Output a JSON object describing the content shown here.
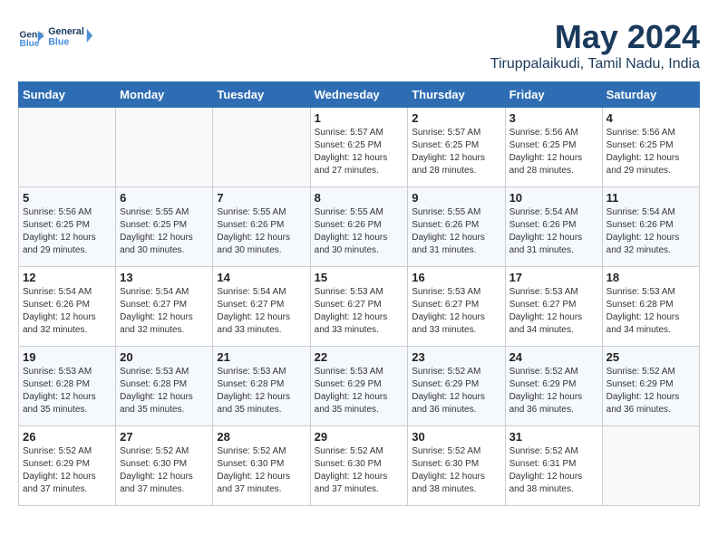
{
  "logo": {
    "text_general": "General",
    "text_blue": "Blue"
  },
  "title": "May 2024",
  "location": "Tiruppalaikudi, Tamil Nadu, India",
  "weekdays": [
    "Sunday",
    "Monday",
    "Tuesday",
    "Wednesday",
    "Thursday",
    "Friday",
    "Saturday"
  ],
  "weeks": [
    [
      {
        "day": "",
        "info": ""
      },
      {
        "day": "",
        "info": ""
      },
      {
        "day": "",
        "info": ""
      },
      {
        "day": "1",
        "info": "Sunrise: 5:57 AM\nSunset: 6:25 PM\nDaylight: 12 hours and 27 minutes."
      },
      {
        "day": "2",
        "info": "Sunrise: 5:57 AM\nSunset: 6:25 PM\nDaylight: 12 hours and 28 minutes."
      },
      {
        "day": "3",
        "info": "Sunrise: 5:56 AM\nSunset: 6:25 PM\nDaylight: 12 hours and 28 minutes."
      },
      {
        "day": "4",
        "info": "Sunrise: 5:56 AM\nSunset: 6:25 PM\nDaylight: 12 hours and 29 minutes."
      }
    ],
    [
      {
        "day": "5",
        "info": "Sunrise: 5:56 AM\nSunset: 6:25 PM\nDaylight: 12 hours and 29 minutes."
      },
      {
        "day": "6",
        "info": "Sunrise: 5:55 AM\nSunset: 6:25 PM\nDaylight: 12 hours and 30 minutes."
      },
      {
        "day": "7",
        "info": "Sunrise: 5:55 AM\nSunset: 6:26 PM\nDaylight: 12 hours and 30 minutes."
      },
      {
        "day": "8",
        "info": "Sunrise: 5:55 AM\nSunset: 6:26 PM\nDaylight: 12 hours and 30 minutes."
      },
      {
        "day": "9",
        "info": "Sunrise: 5:55 AM\nSunset: 6:26 PM\nDaylight: 12 hours and 31 minutes."
      },
      {
        "day": "10",
        "info": "Sunrise: 5:54 AM\nSunset: 6:26 PM\nDaylight: 12 hours and 31 minutes."
      },
      {
        "day": "11",
        "info": "Sunrise: 5:54 AM\nSunset: 6:26 PM\nDaylight: 12 hours and 32 minutes."
      }
    ],
    [
      {
        "day": "12",
        "info": "Sunrise: 5:54 AM\nSunset: 6:26 PM\nDaylight: 12 hours and 32 minutes."
      },
      {
        "day": "13",
        "info": "Sunrise: 5:54 AM\nSunset: 6:27 PM\nDaylight: 12 hours and 32 minutes."
      },
      {
        "day": "14",
        "info": "Sunrise: 5:54 AM\nSunset: 6:27 PM\nDaylight: 12 hours and 33 minutes."
      },
      {
        "day": "15",
        "info": "Sunrise: 5:53 AM\nSunset: 6:27 PM\nDaylight: 12 hours and 33 minutes."
      },
      {
        "day": "16",
        "info": "Sunrise: 5:53 AM\nSunset: 6:27 PM\nDaylight: 12 hours and 33 minutes."
      },
      {
        "day": "17",
        "info": "Sunrise: 5:53 AM\nSunset: 6:27 PM\nDaylight: 12 hours and 34 minutes."
      },
      {
        "day": "18",
        "info": "Sunrise: 5:53 AM\nSunset: 6:28 PM\nDaylight: 12 hours and 34 minutes."
      }
    ],
    [
      {
        "day": "19",
        "info": "Sunrise: 5:53 AM\nSunset: 6:28 PM\nDaylight: 12 hours and 35 minutes."
      },
      {
        "day": "20",
        "info": "Sunrise: 5:53 AM\nSunset: 6:28 PM\nDaylight: 12 hours and 35 minutes."
      },
      {
        "day": "21",
        "info": "Sunrise: 5:53 AM\nSunset: 6:28 PM\nDaylight: 12 hours and 35 minutes."
      },
      {
        "day": "22",
        "info": "Sunrise: 5:53 AM\nSunset: 6:29 PM\nDaylight: 12 hours and 35 minutes."
      },
      {
        "day": "23",
        "info": "Sunrise: 5:52 AM\nSunset: 6:29 PM\nDaylight: 12 hours and 36 minutes."
      },
      {
        "day": "24",
        "info": "Sunrise: 5:52 AM\nSunset: 6:29 PM\nDaylight: 12 hours and 36 minutes."
      },
      {
        "day": "25",
        "info": "Sunrise: 5:52 AM\nSunset: 6:29 PM\nDaylight: 12 hours and 36 minutes."
      }
    ],
    [
      {
        "day": "26",
        "info": "Sunrise: 5:52 AM\nSunset: 6:29 PM\nDaylight: 12 hours and 37 minutes."
      },
      {
        "day": "27",
        "info": "Sunrise: 5:52 AM\nSunset: 6:30 PM\nDaylight: 12 hours and 37 minutes."
      },
      {
        "day": "28",
        "info": "Sunrise: 5:52 AM\nSunset: 6:30 PM\nDaylight: 12 hours and 37 minutes."
      },
      {
        "day": "29",
        "info": "Sunrise: 5:52 AM\nSunset: 6:30 PM\nDaylight: 12 hours and 37 minutes."
      },
      {
        "day": "30",
        "info": "Sunrise: 5:52 AM\nSunset: 6:30 PM\nDaylight: 12 hours and 38 minutes."
      },
      {
        "day": "31",
        "info": "Sunrise: 5:52 AM\nSunset: 6:31 PM\nDaylight: 12 hours and 38 minutes."
      },
      {
        "day": "",
        "info": ""
      }
    ]
  ]
}
